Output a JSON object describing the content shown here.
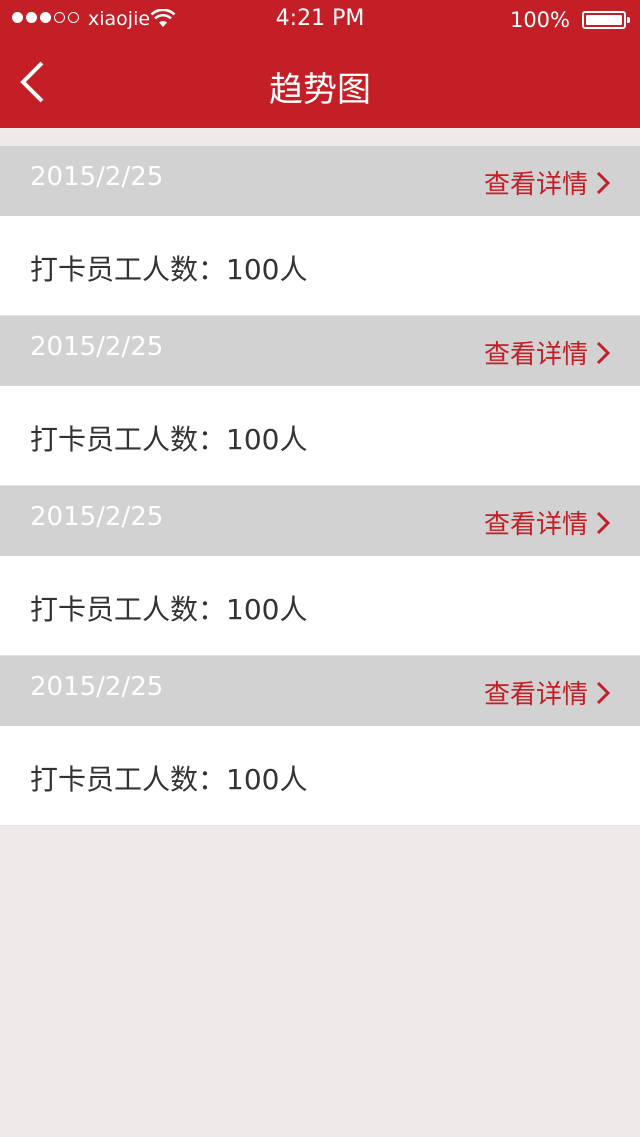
{
  "status_bar": {
    "carrier": "xiaojie",
    "time": "4:21 PM",
    "battery": "100%"
  },
  "nav": {
    "title": "趋势图"
  },
  "items": [
    {
      "date": "2015/2/25",
      "detail_label": "查看详情",
      "count_text": "打卡员工人数：100人"
    },
    {
      "date": "2015/2/25",
      "detail_label": "查看详情",
      "count_text": "打卡员工人数：100人"
    },
    {
      "date": "2015/2/25",
      "detail_label": "查看详情",
      "count_text": "打卡员工人数：100人"
    },
    {
      "date": "2015/2/25",
      "detail_label": "查看详情",
      "count_text": "打卡员工人数：100人"
    }
  ],
  "colors": {
    "brand_red": "#c41e26",
    "section_gray": "#d2d2d2",
    "background": "#edeae9"
  },
  "icons": [
    "signal-icon",
    "wifi-icon",
    "battery-icon",
    "back-arrow-icon",
    "chevron-right-icon"
  ]
}
